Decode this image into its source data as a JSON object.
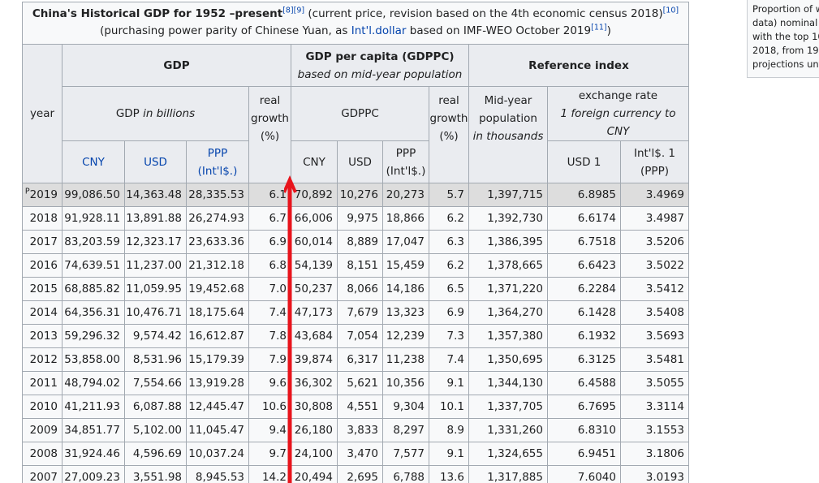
{
  "caption": {
    "title": "China's Historical GDP for 1952 –present",
    "title_sup": "[8][9]",
    "line1_rest": " (current price, revision based on the 4th economic census 2018)",
    "line1_sup": "[10]",
    "line2_pre": "(purchasing power parity of Chinese Yuan, as ",
    "line2_link": "Int'l.dollar",
    "line2_post": " based on IMF-WEO October 2019",
    "line2_sup": "[11]",
    "line2_end": ")"
  },
  "headers": {
    "year": "year",
    "gdp": "GDP",
    "gdppc_title": "GDP per capita (GDPPC)",
    "gdppc_sub": "based on mid-year population",
    "ref_index": "Reference index",
    "gdp_in_billions_pre": "GDP ",
    "gdp_in_billions_italic": "in billions",
    "real_growth": "real growth (%)",
    "gdppc": "GDPPC",
    "real_growth2": "real growth (%)",
    "midyear_pop": "Mid-year population",
    "in_thousands": "in thousands",
    "exchange_rate": "exchange rate",
    "exchange_sub": "1 foreign currency to CNY",
    "cny": "CNY",
    "usd": "USD",
    "ppp": "PPP",
    "intl": "(Int'l$.)",
    "cny2": "CNY",
    "usd2": "USD",
    "ppp2": "PPP",
    "intl2": "(Int'l$.)",
    "usd1": "USD 1",
    "intl_ppp_line1": "Int'l$. 1",
    "intl_ppp_line2": "(PPP)"
  },
  "rows": [
    {
      "year": "2019",
      "prefix": "P",
      "cny": "99,086.50",
      "usd": "14,363.48",
      "ppp": "28,335.53",
      "growth": "6.1",
      "pc_cny": "70,892",
      "pc_usd": "10,276",
      "pc_ppp": "20,273",
      "pc_growth": "5.7",
      "pop": "1,397,715",
      "usd1": "6.8985",
      "ppp1": "3.4969"
    },
    {
      "year": "2018",
      "prefix": "",
      "cny": "91,928.11",
      "usd": "13,891.88",
      "ppp": "26,274.93",
      "growth": "6.7",
      "pc_cny": "66,006",
      "pc_usd": "9,975",
      "pc_ppp": "18,866",
      "pc_growth": "6.2",
      "pop": "1,392,730",
      "usd1": "6.6174",
      "ppp1": "3.4987"
    },
    {
      "year": "2017",
      "prefix": "",
      "cny": "83,203.59",
      "usd": "12,323.17",
      "ppp": "23,633.36",
      "growth": "6.9",
      "pc_cny": "60,014",
      "pc_usd": "8,889",
      "pc_ppp": "17,047",
      "pc_growth": "6.3",
      "pop": "1,386,395",
      "usd1": "6.7518",
      "ppp1": "3.5206"
    },
    {
      "year": "2016",
      "prefix": "",
      "cny": "74,639.51",
      "usd": "11,237.00",
      "ppp": "21,312.18",
      "growth": "6.8",
      "pc_cny": "54,139",
      "pc_usd": "8,151",
      "pc_ppp": "15,459",
      "pc_growth": "6.2",
      "pop": "1,378,665",
      "usd1": "6.6423",
      "ppp1": "3.5022"
    },
    {
      "year": "2015",
      "prefix": "",
      "cny": "68,885.82",
      "usd": "11,059.95",
      "ppp": "19,452.68",
      "growth": "7.0",
      "pc_cny": "50,237",
      "pc_usd": "8,066",
      "pc_ppp": "14,186",
      "pc_growth": "6.5",
      "pop": "1,371,220",
      "usd1": "6.2284",
      "ppp1": "3.5412"
    },
    {
      "year": "2014",
      "prefix": "",
      "cny": "64,356.31",
      "usd": "10,476.71",
      "ppp": "18,175.64",
      "growth": "7.4",
      "pc_cny": "47,173",
      "pc_usd": "7,679",
      "pc_ppp": "13,323",
      "pc_growth": "6.9",
      "pop": "1,364,270",
      "usd1": "6.1428",
      "ppp1": "3.5408"
    },
    {
      "year": "2013",
      "prefix": "",
      "cny": "59,296.32",
      "usd": "9,574.42",
      "ppp": "16,612.87",
      "growth": "7.8",
      "pc_cny": "43,684",
      "pc_usd": "7,054",
      "pc_ppp": "12,239",
      "pc_growth": "7.3",
      "pop": "1,357,380",
      "usd1": "6.1932",
      "ppp1": "3.5693"
    },
    {
      "year": "2012",
      "prefix": "",
      "cny": "53,858.00",
      "usd": "8,531.96",
      "ppp": "15,179.39",
      "growth": "7.9",
      "pc_cny": "39,874",
      "pc_usd": "6,317",
      "pc_ppp": "11,238",
      "pc_growth": "7.4",
      "pop": "1,350,695",
      "usd1": "6.3125",
      "ppp1": "3.5481"
    },
    {
      "year": "2011",
      "prefix": "",
      "cny": "48,794.02",
      "usd": "7,554.66",
      "ppp": "13,919.28",
      "growth": "9.6",
      "pc_cny": "36,302",
      "pc_usd": "5,621",
      "pc_ppp": "10,356",
      "pc_growth": "9.1",
      "pop": "1,344,130",
      "usd1": "6.4588",
      "ppp1": "3.5055"
    },
    {
      "year": "2010",
      "prefix": "",
      "cny": "41,211.93",
      "usd": "6,087.88",
      "ppp": "12,445.47",
      "growth": "10.6",
      "pc_cny": "30,808",
      "pc_usd": "4,551",
      "pc_ppp": "9,304",
      "pc_growth": "10.1",
      "pop": "1,337,705",
      "usd1": "6.7695",
      "ppp1": "3.3114"
    },
    {
      "year": "2009",
      "prefix": "",
      "cny": "34,851.77",
      "usd": "5,102.00",
      "ppp": "11,045.47",
      "growth": "9.4",
      "pc_cny": "26,180",
      "pc_usd": "3,833",
      "pc_ppp": "8,297",
      "pc_growth": "8.9",
      "pop": "1,331,260",
      "usd1": "6.8310",
      "ppp1": "3.1553"
    },
    {
      "year": "2008",
      "prefix": "",
      "cny": "31,924.46",
      "usd": "4,596.69",
      "ppp": "10,037.24",
      "growth": "9.7",
      "pc_cny": "24,100",
      "pc_usd": "3,470",
      "pc_ppp": "7,577",
      "pc_growth": "9.1",
      "pop": "1,324,655",
      "usd1": "6.9451",
      "ppp1": "3.1806"
    },
    {
      "year": "2007",
      "prefix": "",
      "cny": "27,009.23",
      "usd": "3,551.98",
      "ppp": "8,945.53",
      "growth": "14.2",
      "pc_cny": "20,494",
      "pc_usd": "2,695",
      "pc_ppp": "6,788",
      "pc_growth": "13.6",
      "pop": "1,317,885",
      "usd1": "7.6040",
      "ppp1": "3.0193"
    }
  ],
  "sidebar": {
    "lines": [
      "Proportion of w",
      "data) nominal C",
      "with the top 10",
      "2018, from 198",
      "projections unt"
    ]
  },
  "colors": {
    "arrow": "#e8141c",
    "link": "#0645ad",
    "header_bg": "#eaecf0",
    "row_highlight": "#dddddd"
  }
}
